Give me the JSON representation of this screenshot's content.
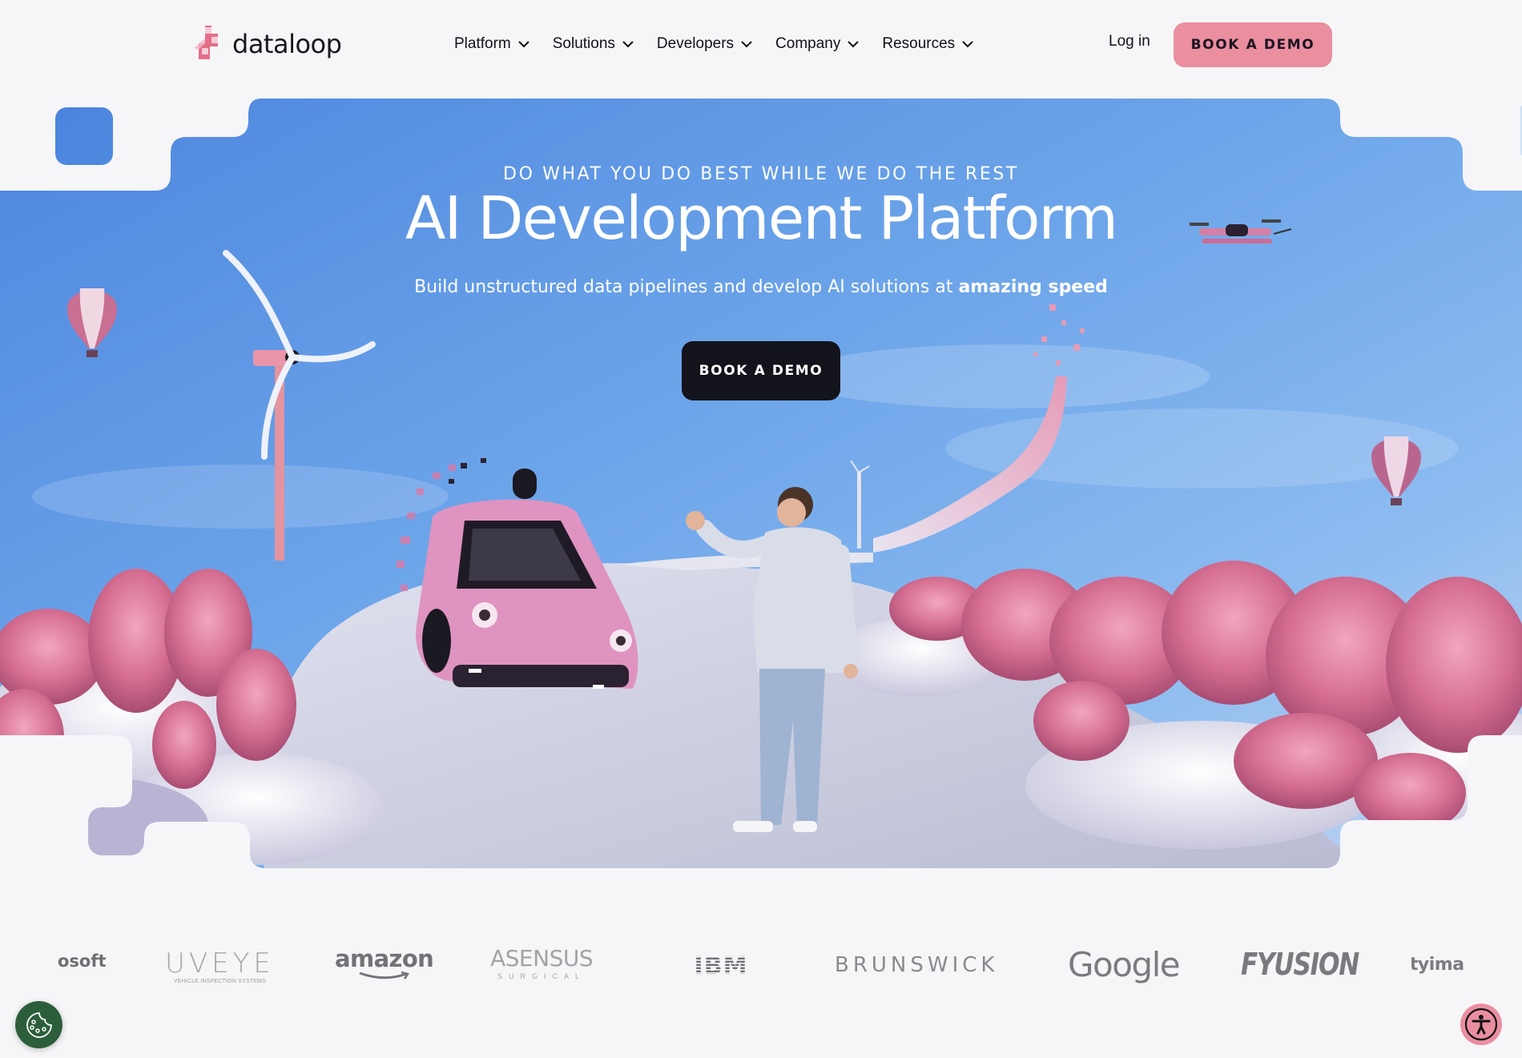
{
  "brand": {
    "name": "dataloop",
    "accent_pink": "#ea8ea0",
    "dark": "#13131b",
    "sky_blue": "#5a93e2"
  },
  "header": {
    "nav": [
      {
        "label": "Platform",
        "icon": "chevron-down-icon"
      },
      {
        "label": "Solutions",
        "icon": "chevron-down-icon"
      },
      {
        "label": "Developers",
        "icon": "chevron-down-icon"
      },
      {
        "label": "Company",
        "icon": "chevron-down-icon"
      },
      {
        "label": "Resources",
        "icon": "chevron-down-icon"
      }
    ],
    "login_label": "Log in",
    "cta_label": "BOOK A DEMO"
  },
  "hero": {
    "eyebrow": "DO WHAT YOU DO BEST WHILE WE DO THE REST",
    "title": "AI Development Platform",
    "subtitle_prefix": "Build unstructured data pipelines and develop AI solutions at ",
    "subtitle_emphasis": "amazing speed",
    "cta_label": "BOOK A DEMO",
    "image_description": "Pink car driving on a white road in the sky beside a man waving; pink wind turbine, hot-air balloons, drone, pink trees and clouds"
  },
  "clients": [
    {
      "name": "Microsoft",
      "visible_text": "osoft"
    },
    {
      "name": "UVeye",
      "visible_text": "UVEYE",
      "tagline": "VEHICLE INSPECTION SYSTEMS"
    },
    {
      "name": "Amazon",
      "visible_text": "amazon"
    },
    {
      "name": "Asensus Surgical",
      "visible_text": "ASENSUS",
      "tagline": "SURGICAL"
    },
    {
      "name": "IBM",
      "visible_text": "IBM"
    },
    {
      "name": "Brunswick",
      "visible_text": "BRUNSWICK"
    },
    {
      "name": "Google",
      "visible_text": "Google"
    },
    {
      "name": "Fyusion",
      "visible_text": "FYUSION"
    },
    {
      "name": "Getty Images",
      "visible_text": "gettyimages"
    }
  ],
  "floating": {
    "cookie_icon": "cookie-icon",
    "accessibility_icon": "accessibility-icon"
  }
}
